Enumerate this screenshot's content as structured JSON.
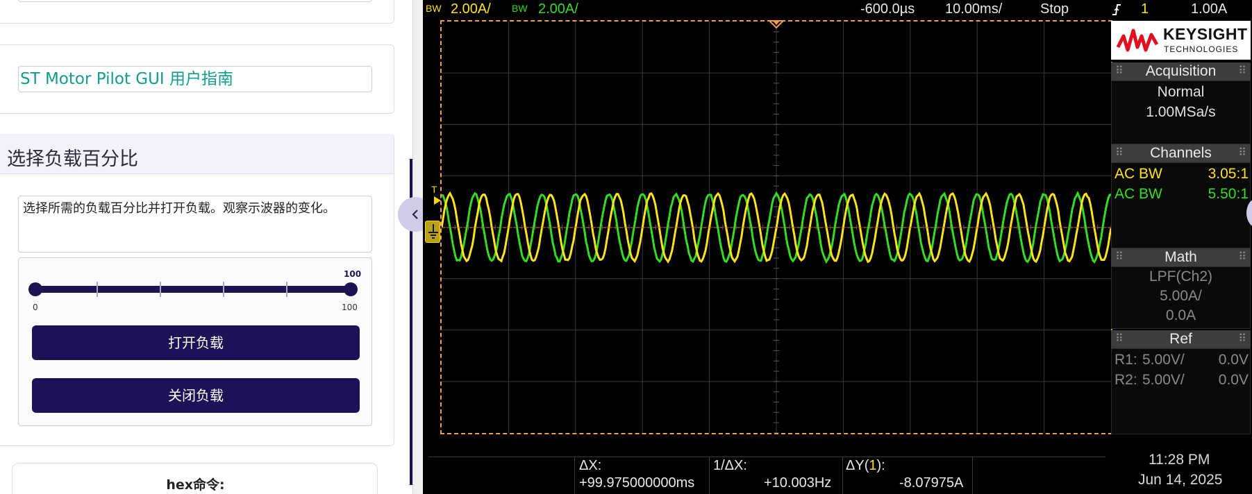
{
  "left_panel": {
    "guide_link": "ST Motor Pilot GUI 用户指南",
    "load_section": {
      "title": "选择负载百分比",
      "description": "选择所需的负载百分比并打开负载。观察示波器的变化。",
      "slider": {
        "value": 100,
        "value_label": "100",
        "min_label": "0",
        "max_label": "100"
      },
      "open_button": "打开负载",
      "close_button": "关闭负载"
    },
    "hex_label": "hex命令:"
  },
  "scope": {
    "topbar": {
      "ch1_bw": "BW",
      "ch1_scale": "2.00A/",
      "ch2_bw": "BW",
      "ch2_scale": "2.00A/",
      "time_offset": "-600.0µs",
      "time_scale": "10.00ms/",
      "run_state": "Stop",
      "trigger_icon": "trigger-edge-icon",
      "trigger_channel": "1",
      "trigger_level": "1.00A"
    },
    "logo": {
      "name": "KEYSIGHT",
      "sub": "TECHNOLOGIES"
    },
    "acquisition": {
      "title": "Acquisition",
      "mode": "Normal",
      "rate": "1.00MSa/s"
    },
    "channels": {
      "title": "Channels",
      "ch1": {
        "coupling": "AC BW",
        "probe": "3.05:1"
      },
      "ch2": {
        "coupling": "AC BW",
        "probe": "5.50:1"
      }
    },
    "math": {
      "title": "Math",
      "function": "LPF(Ch2)",
      "scale": "5.00A/",
      "offset": "0.0A"
    },
    "ref": {
      "title": "Ref",
      "r1": {
        "label": "R1:",
        "scale": "5.00V/",
        "offset": "0.0V"
      },
      "r2": {
        "label": "R2:",
        "scale": "5.00V/",
        "offset": "0.0V"
      }
    },
    "measurements": {
      "dx_label": "ΔX:",
      "dx_value": "+99.975000000ms",
      "inv_dx_label": "1/ΔX:",
      "inv_dx_value": "+10.003Hz",
      "dy_label_prefix": "ΔY(",
      "dy_channel": "1",
      "dy_label_suffix": "):",
      "dy_value": "-8.07975A"
    },
    "clock": {
      "time": "11:28 PM",
      "date": "Jun 14, 2025"
    },
    "markers": {
      "trigger_t": "T"
    },
    "waveforms": {
      "ch1_color": "#ffe31a",
      "ch2_color": "#33dd22",
      "cycles_on_screen": 20,
      "ch1_phase_div": 0.0,
      "ch2_phase_div": 0.5
    },
    "colors": {
      "ch1": "#ffe31a",
      "ch2": "#33dd22",
      "frame": "#f0a050"
    }
  }
}
